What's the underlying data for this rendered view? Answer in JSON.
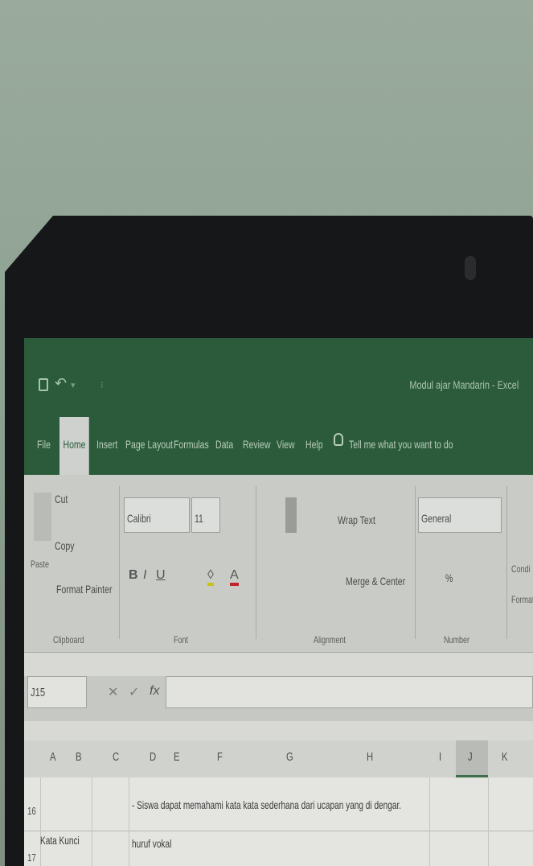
{
  "window": {
    "title": "Modul ajar Mandarin - Excel"
  },
  "tabs": [
    {
      "label": "File"
    },
    {
      "label": "Home"
    },
    {
      "label": "Insert"
    },
    {
      "label": "Page Layout"
    },
    {
      "label": "Formulas"
    },
    {
      "label": "Data"
    },
    {
      "label": "Review"
    },
    {
      "label": "View"
    },
    {
      "label": "Help"
    },
    {
      "label": "Tell me what you want to do"
    }
  ],
  "ribbon": {
    "clipboard": {
      "cut": "Cut",
      "copy": "Copy",
      "paste": "Paste",
      "format_painter": "Format Painter",
      "group": "Clipboard"
    },
    "font": {
      "name": "Calibri",
      "size": "11",
      "group": "Font"
    },
    "alignment": {
      "wrap": "Wrap Text",
      "merge": "Merge & Center",
      "group": "Alignment"
    },
    "number": {
      "format": "General",
      "percent": "%",
      "group": "Number"
    },
    "styles": {
      "cond1": "Condi",
      "cond2": "Format"
    }
  },
  "formula_bar": {
    "name_box": "J15",
    "fx": "fx"
  },
  "columns": [
    "A",
    "B",
    "C",
    "D",
    "E",
    "F",
    "G",
    "H",
    "I",
    "J",
    "K"
  ],
  "rows": [
    {
      "num": "16",
      "text": "- Siswa dapat memahami kata kata sederhana dari ucapan yang di dengar."
    },
    {
      "num": "17",
      "label": "Kata Kunci",
      "text": "huruf vokal"
    }
  ]
}
